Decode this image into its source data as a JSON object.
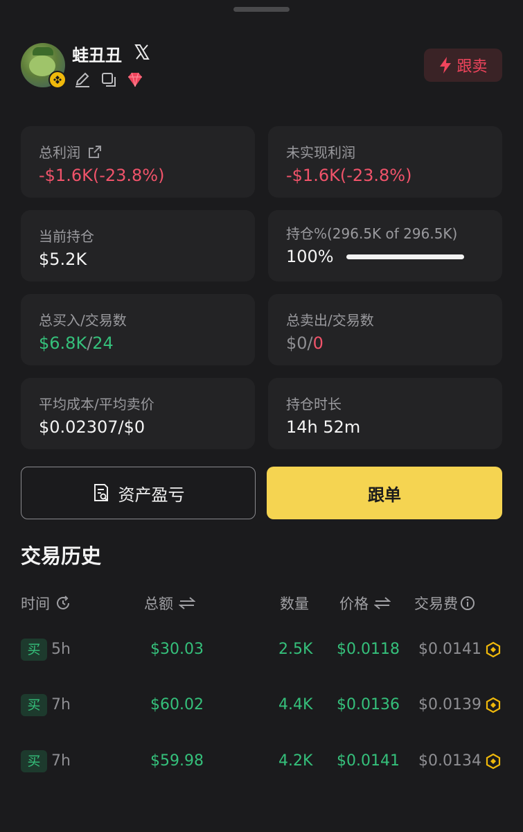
{
  "header": {
    "username": "蛙丑丑",
    "sell_button": "跟卖"
  },
  "stats": [
    {
      "label": "总利润",
      "value": "-$1.6K(-23.8%)"
    },
    {
      "label": "未实现利润",
      "value": "-$1.6K(-23.8%)"
    },
    {
      "label": "当前持仓",
      "value": "$5.2K"
    },
    {
      "label": "持仓%(296.5K of 296.5K)",
      "value": "100%",
      "progress": 1.0
    },
    {
      "label": "总买入/交易数",
      "value_amount": "$6.8K",
      "value_sep": "/",
      "value_count": "24"
    },
    {
      "label": "总卖出/交易数",
      "value_amount": "$0",
      "value_sep": "/",
      "value_count": "0"
    },
    {
      "label": "平均成本/平均卖价",
      "value": "$0.02307/$0"
    },
    {
      "label": "持仓时长",
      "value": "14h 52m"
    }
  ],
  "actions": {
    "pnl_button": "资产盈亏",
    "follow_button": "跟单"
  },
  "history": {
    "title": "交易历史",
    "columns": [
      "时间",
      "总额",
      "数量",
      "价格",
      "交易费"
    ],
    "rows": [
      {
        "side": "买",
        "time": "5h",
        "total": "$30.03",
        "qty": "2.5K",
        "price": "$0.0118",
        "fee": "$0.0141"
      },
      {
        "side": "买",
        "time": "7h",
        "total": "$60.02",
        "qty": "4.4K",
        "price": "$0.0136",
        "fee": "$0.0139"
      },
      {
        "side": "买",
        "time": "7h",
        "total": "$59.98",
        "qty": "4.2K",
        "price": "$0.0141",
        "fee": "$0.0134"
      }
    ]
  },
  "colors": {
    "background": "#1b1b1d",
    "card": "#232325",
    "loss_red": "#f0536a",
    "gain_green": "#35c07b",
    "accent_yellow": "#f5d451"
  },
  "icons": [
    "x-logo-icon",
    "edit-icon",
    "copy-icon",
    "gem-icon",
    "bolt-icon",
    "share-icon",
    "report-icon",
    "refresh-clock-icon",
    "sort-icon",
    "info-icon",
    "bnb-icon"
  ]
}
